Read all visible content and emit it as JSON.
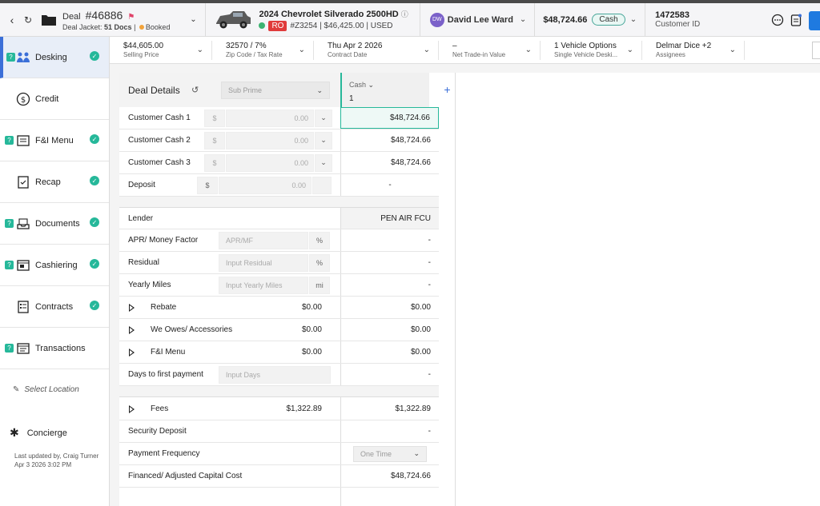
{
  "header": {
    "deal_label": "Deal",
    "deal_number": "#46886",
    "deal_jacket_label": "Deal Jacket:",
    "docs_count": "51 Docs",
    "deal_status": "Booked",
    "vehicle_title": "2024 Chevrolet Silverado 2500HD",
    "ro_badge": "RO",
    "vehicle_stock": "#Z3254 | $46,425.00 | USED",
    "customer_initials": "DW",
    "customer_name": "David Lee Ward",
    "total_amount": "$48,724.66",
    "payment_type": "Cash",
    "customer_id": "1472583",
    "customer_id_label": "Customer ID"
  },
  "subbar": [
    {
      "value": "$44,605.00",
      "label": "Selling Price"
    },
    {
      "value": "32570 / 7%",
      "label": "Zip Code / Tax Rate"
    },
    {
      "value": "Thu Apr 2 2026",
      "label": "Contract Date"
    },
    {
      "value": "–",
      "label": "Net Trade-in Value"
    },
    {
      "value": "1 Vehicle Options",
      "label": "Single Vehicle Deski..."
    },
    {
      "value": "Delmar Dice +2",
      "label": "Assignees"
    }
  ],
  "sidebar": {
    "items": [
      {
        "label": "Desking",
        "checked": true,
        "badge": true
      },
      {
        "label": "Credit",
        "checked": false,
        "badge": false
      },
      {
        "label": "F&I Menu",
        "checked": true,
        "badge": true
      },
      {
        "label": "Recap",
        "checked": true,
        "badge": false
      },
      {
        "label": "Documents",
        "checked": true,
        "badge": true
      },
      {
        "label": "Cashiering",
        "checked": true,
        "badge": true
      },
      {
        "label": "Contracts",
        "checked": true,
        "badge": false
      },
      {
        "label": "Transactions",
        "checked": false,
        "badge": true
      }
    ],
    "select_location": "Select Location",
    "concierge": "Concierge",
    "updated_line1": "Last updated by, Craig Turner",
    "updated_line2": "Apr 3 2026 3:02 PM"
  },
  "deal": {
    "title": "Deal Details",
    "subprime_placeholder": "Sub Prime",
    "cash_col_label": "Cash",
    "cash_col_num": "1",
    "dollar": "$",
    "zero": "0.00",
    "rows_top": [
      {
        "label": "Customer Cash 1",
        "value": "$48,724.66"
      },
      {
        "label": "Customer Cash 2",
        "value": "$48,724.66"
      },
      {
        "label": "Customer Cash 3",
        "value": "$48,724.66"
      },
      {
        "label": "Deposit",
        "value": "-"
      }
    ],
    "lender_label": "Lender",
    "lender_value": "PEN AIR FCU",
    "apr_label": "APR/ Money Factor",
    "apr_placeholder": "APR/MF",
    "apr_unit": "%",
    "apr_value": "-",
    "residual_label": "Residual",
    "residual_placeholder": "Input Residual",
    "residual_unit": "%",
    "residual_value": "-",
    "miles_label": "Yearly Miles",
    "miles_placeholder": "Input Yearly Miles",
    "miles_unit": "mi",
    "miles_value": "-",
    "rebate_label": "Rebate",
    "rebate_mid": "$0.00",
    "rebate_value": "$0.00",
    "weowes_label": "We Owes/ Accessories",
    "weowes_mid": "$0.00",
    "weowes_value": "$0.00",
    "fimenu_label": "F&I Menu",
    "fimenu_mid": "$0.00",
    "fimenu_value": "$0.00",
    "days_label": "Days to first payment",
    "days_placeholder": "Input Days",
    "days_value": "-",
    "fees_label": "Fees",
    "fees_mid": "$1,322.89",
    "fees_value": "$1,322.89",
    "secdep_label": "Security Deposit",
    "secdep_value": "-",
    "payfreq_label": "Payment Frequency",
    "payfreq_value": "One Time",
    "financed_label": "Financed/ Adjusted Capital Cost",
    "financed_value": "$48,724.66"
  }
}
